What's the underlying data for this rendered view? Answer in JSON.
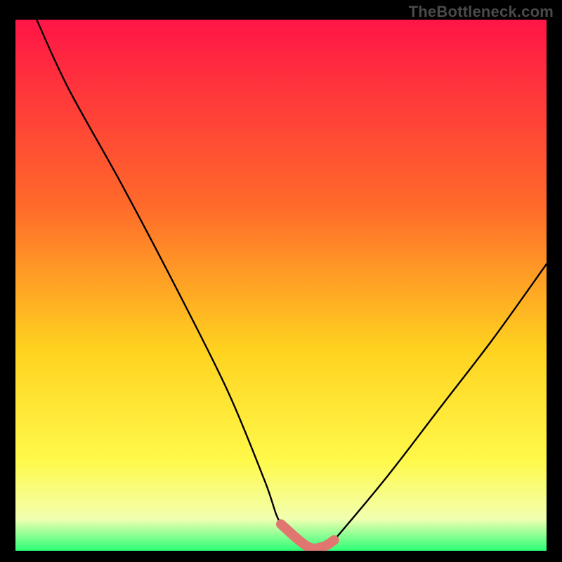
{
  "watermark": "TheBottleneck.com",
  "colors": {
    "bg": "#000000",
    "grad_top": "#ff1546",
    "grad_mid1": "#ff6a2a",
    "grad_mid2": "#ffd21f",
    "grad_mid3": "#fff94a",
    "grad_bottom": "#2bff77",
    "curve": "#000000",
    "highlight": "#e0766f"
  },
  "chart_data": {
    "type": "line",
    "title": "",
    "xlabel": "",
    "ylabel": "",
    "xlim": [
      0,
      100
    ],
    "ylim": [
      0,
      100
    ],
    "series": [
      {
        "name": "bottleneck-curve",
        "x": [
          4,
          10,
          20,
          30,
          40,
          47,
          50,
          55,
          58,
          60,
          70,
          80,
          90,
          100
        ],
        "y": [
          100,
          87,
          69,
          50,
          30,
          13,
          5,
          0,
          0,
          2,
          14,
          27,
          40,
          54
        ]
      }
    ],
    "highlight_range_x": [
      50,
      58
    ],
    "annotations": []
  }
}
